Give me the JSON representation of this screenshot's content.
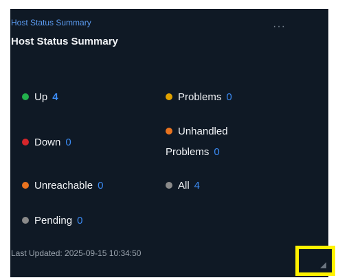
{
  "widget": {
    "subtitle": "Host Status Summary",
    "title": "Host Status Summary",
    "menu_icon": "more-horizontal-icon",
    "last_updated": "Last Updated: 2025-09-15 10:34:50"
  },
  "stats": {
    "up": {
      "label": "Up",
      "count": "4",
      "color": "#22b14c"
    },
    "problems": {
      "label": "Problems",
      "count": "0",
      "color": "#e0a100"
    },
    "down": {
      "label": "Down",
      "count": "0",
      "color": "#d6262b"
    },
    "unhandled": {
      "label_line1": "Unhandled",
      "label_line2": "Problems",
      "count": "0",
      "color": "#e8731f"
    },
    "unreachable": {
      "label": "Unreachable",
      "count": "0",
      "color": "#e8731f"
    },
    "all": {
      "label": "All",
      "count": "4",
      "color": "#8a8a8a"
    },
    "pending": {
      "label": "Pending",
      "count": "0",
      "color": "#8a8a8a"
    }
  },
  "colors": {
    "background": "#0f1925",
    "accent": "#3b8bf4",
    "highlight": "#fff200"
  }
}
